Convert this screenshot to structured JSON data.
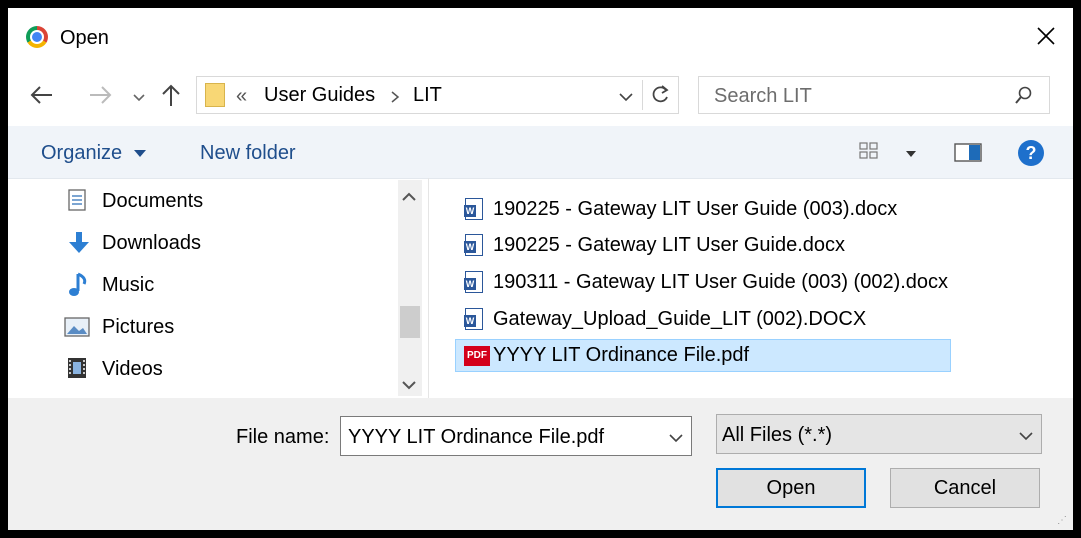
{
  "window": {
    "title": "Open"
  },
  "nav": {
    "breadcrumb_overflow": "«",
    "breadcrumb": [
      "User Guides",
      "LIT"
    ],
    "search_placeholder": "Search LIT"
  },
  "toolbar": {
    "organize_label": "Organize",
    "new_folder_label": "New folder"
  },
  "sidebar": {
    "items": [
      {
        "label": "Documents",
        "icon": "documents-icon"
      },
      {
        "label": "Downloads",
        "icon": "downloads-icon"
      },
      {
        "label": "Music",
        "icon": "music-icon"
      },
      {
        "label": "Pictures",
        "icon": "pictures-icon"
      },
      {
        "label": "Videos",
        "icon": "videos-icon"
      }
    ]
  },
  "files": [
    {
      "name": "190225 - Gateway LIT User Guide (003).docx",
      "type": "word",
      "selected": false
    },
    {
      "name": "190225 - Gateway LIT User Guide.docx",
      "type": "word",
      "selected": false
    },
    {
      "name": "190311 - Gateway LIT User Guide (003) (002).docx",
      "type": "word",
      "selected": false
    },
    {
      "name": "Gateway_Upload_Guide_LIT (002).DOCX",
      "type": "word",
      "selected": false
    },
    {
      "name": "YYYY LIT Ordinance File.pdf",
      "type": "pdf",
      "selected": true
    }
  ],
  "pdf_icon_label": "PDF",
  "footer": {
    "file_name_label": "File name:",
    "file_name_value": "YYYY LIT Ordinance File.pdf",
    "file_type_value": "All Files (*.*)",
    "open_label": "Open",
    "cancel_label": "Cancel"
  },
  "colors": {
    "accent": "#0078d7",
    "selection": "#cce8ff",
    "link_text": "#1f4e8c"
  }
}
